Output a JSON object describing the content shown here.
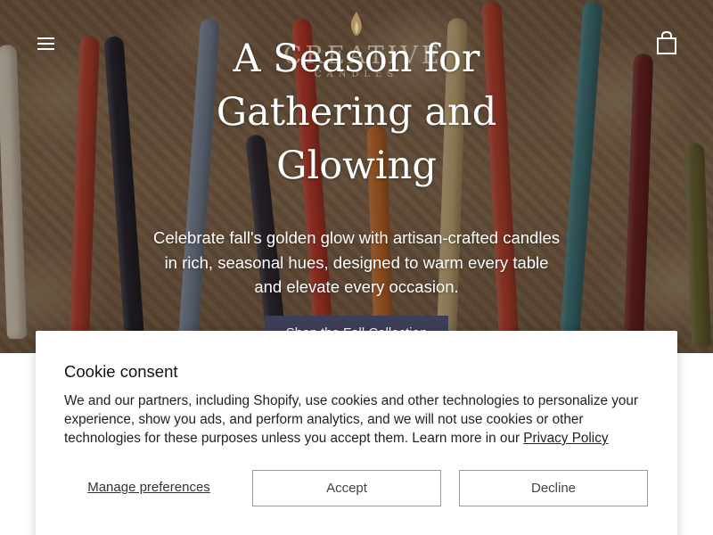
{
  "header": {
    "logo": {
      "wordmark": "CREATIVE",
      "subline": "CANDLES"
    }
  },
  "hero": {
    "title": "A Season for Gathering and Glowing",
    "subtitle": "Celebrate fall's golden glow with artisan-crafted candles in rich, seasonal hues, designed to warm every table and elevate every occasion.",
    "cta_label": "Shop the Fall Collection",
    "cta_color": "#3d3f5a"
  },
  "cookie_consent": {
    "title": "Cookie consent",
    "body": "We and our partners, including Shopify, use cookies and other technologies to personalize your experience, show you ads, and perform analytics, and we will not use cookies or other technologies for these purposes unless you accept them. Learn more in our",
    "privacy_link": "Privacy Policy",
    "manage_label": "Manage preferences",
    "accept_label": "Accept",
    "decline_label": "Decline"
  },
  "icons": {
    "menu": "hamburger-menu-icon",
    "cart": "shopping-bag-icon",
    "logo": "flame-icon"
  }
}
